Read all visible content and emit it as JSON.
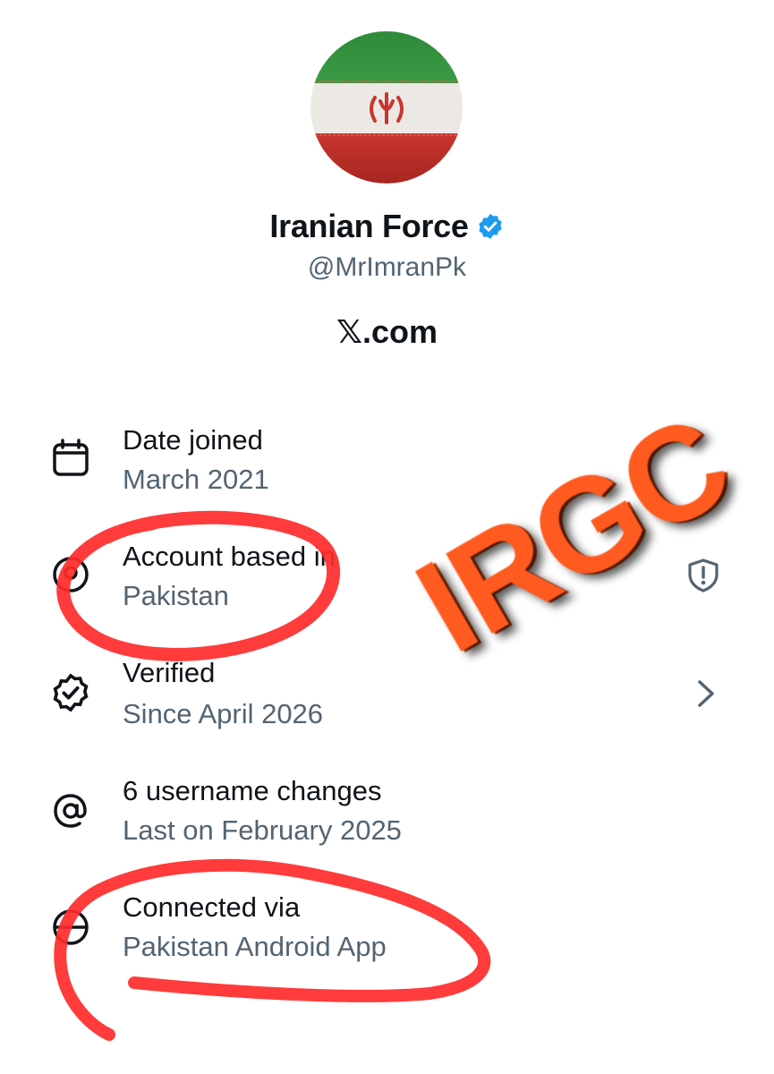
{
  "profile": {
    "name": "Iranian Force",
    "handle": "@MrImranPk",
    "site": "𝕏.com",
    "avatar_icon": "iran-flag-avatar",
    "verified_icon": "verified-badge-icon",
    "verified_color": "#1d9bf0"
  },
  "about": {
    "date_joined": {
      "title": "Date joined",
      "value": "March 2021",
      "icon": "calendar-icon"
    },
    "account_based": {
      "title": "Account based in",
      "value": "Pakistan",
      "icon": "location-icon",
      "right_icon": "shield-alert-icon"
    },
    "verified": {
      "title": "Verified",
      "value": "Since April 2026",
      "icon": "verified-outline-icon",
      "right_icon": "chevron-right-icon"
    },
    "username_changes": {
      "title": "6 username changes",
      "value": "Last on February 2025",
      "icon": "at-icon"
    },
    "connected_via": {
      "title": "Connected via",
      "value": "Pakistan Android App",
      "icon": "globe-icon"
    }
  },
  "overlay": {
    "stamp_text": "IRGC",
    "stamp_color": "#ff5a1f",
    "marker_color": "#ff2a2a"
  }
}
